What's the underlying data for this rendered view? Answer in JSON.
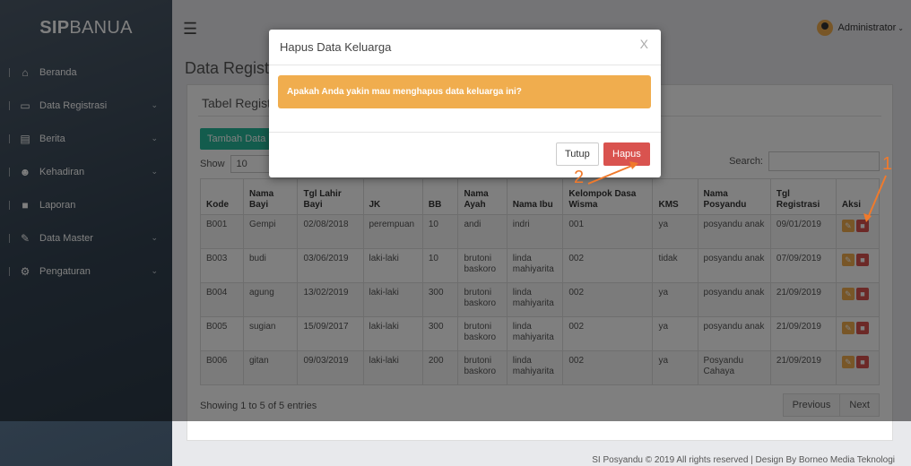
{
  "brand": {
    "bold": "SIP",
    "rest": "BANUA"
  },
  "sidebar": {
    "items": [
      {
        "label": "Beranda",
        "icon": "home-icon",
        "glyph": "⌂",
        "chevron": false
      },
      {
        "label": "Data Registrasi",
        "icon": "monitor-icon",
        "glyph": "▭",
        "chevron": true
      },
      {
        "label": "Berita",
        "icon": "newspaper-icon",
        "glyph": "▤",
        "chevron": true
      },
      {
        "label": "Kehadiran",
        "icon": "users-icon",
        "glyph": "☻",
        "chevron": true
      },
      {
        "label": "Laporan",
        "icon": "file-icon",
        "glyph": "■",
        "chevron": false
      },
      {
        "label": "Data Master",
        "icon": "edit-icon",
        "glyph": "✎",
        "chevron": true
      },
      {
        "label": "Pengaturan",
        "icon": "gear-icon",
        "glyph": "⚙",
        "chevron": true
      }
    ]
  },
  "topbar": {
    "user": "Administrator"
  },
  "page": {
    "title": "Data Registrasi"
  },
  "panel": {
    "title": "Tabel Registrasi",
    "add_button": "Tambah Data",
    "show_label": "Show",
    "show_value": "10",
    "search_label": "Search:",
    "info": "Showing 1 to 5 of 5 entries",
    "prev": "Previous",
    "next": "Next"
  },
  "table": {
    "headers": [
      "Kode",
      "Nama Bayi",
      "Tgl Lahir Bayi",
      "JK",
      "BB",
      "Nama Ayah",
      "Nama Ibu",
      "Kelompok Dasa Wisma",
      "KMS",
      "Nama Posyandu",
      "Tgl Registrasi",
      "Aksi"
    ],
    "rows": [
      [
        "B001",
        "Gempi",
        "02/08/2018",
        "perempuan",
        "10",
        "andi",
        "indri",
        "001",
        "ya",
        "posyandu anak",
        "09/01/2019"
      ],
      [
        "B003",
        "budi",
        "03/06/2019",
        "laki-laki",
        "10",
        "brutoni baskoro",
        "linda mahiyarita",
        "002",
        "tidak",
        "posyandu anak",
        "07/09/2019"
      ],
      [
        "B004",
        "agung",
        "13/02/2019",
        "laki-laki",
        "300",
        "brutoni baskoro",
        "linda mahiyarita",
        "002",
        "ya",
        "posyandu anak",
        "21/09/2019"
      ],
      [
        "B005",
        "sugian",
        "15/09/2017",
        "laki-laki",
        "300",
        "brutoni baskoro",
        "linda mahiyarita",
        "002",
        "ya",
        "posyandu anak",
        "21/09/2019"
      ],
      [
        "B006",
        "gitan",
        "09/03/2019",
        "laki-laki",
        "200",
        "brutoni baskoro",
        "linda mahiyarita",
        "002",
        "ya",
        "Posyandu Cahaya",
        "21/09/2019"
      ]
    ]
  },
  "modal": {
    "title": "Hapus Data Keluarga",
    "close": "X",
    "message": "Apakah Anda yakin mau menghapus data keluarga ini?",
    "cancel": "Tutup",
    "confirm": "Hapus"
  },
  "annotations": {
    "first": "1",
    "second": "2"
  },
  "footer": "SI Posyandu © 2019 All rights reserved | Design By Borneo Media Teknologi"
}
